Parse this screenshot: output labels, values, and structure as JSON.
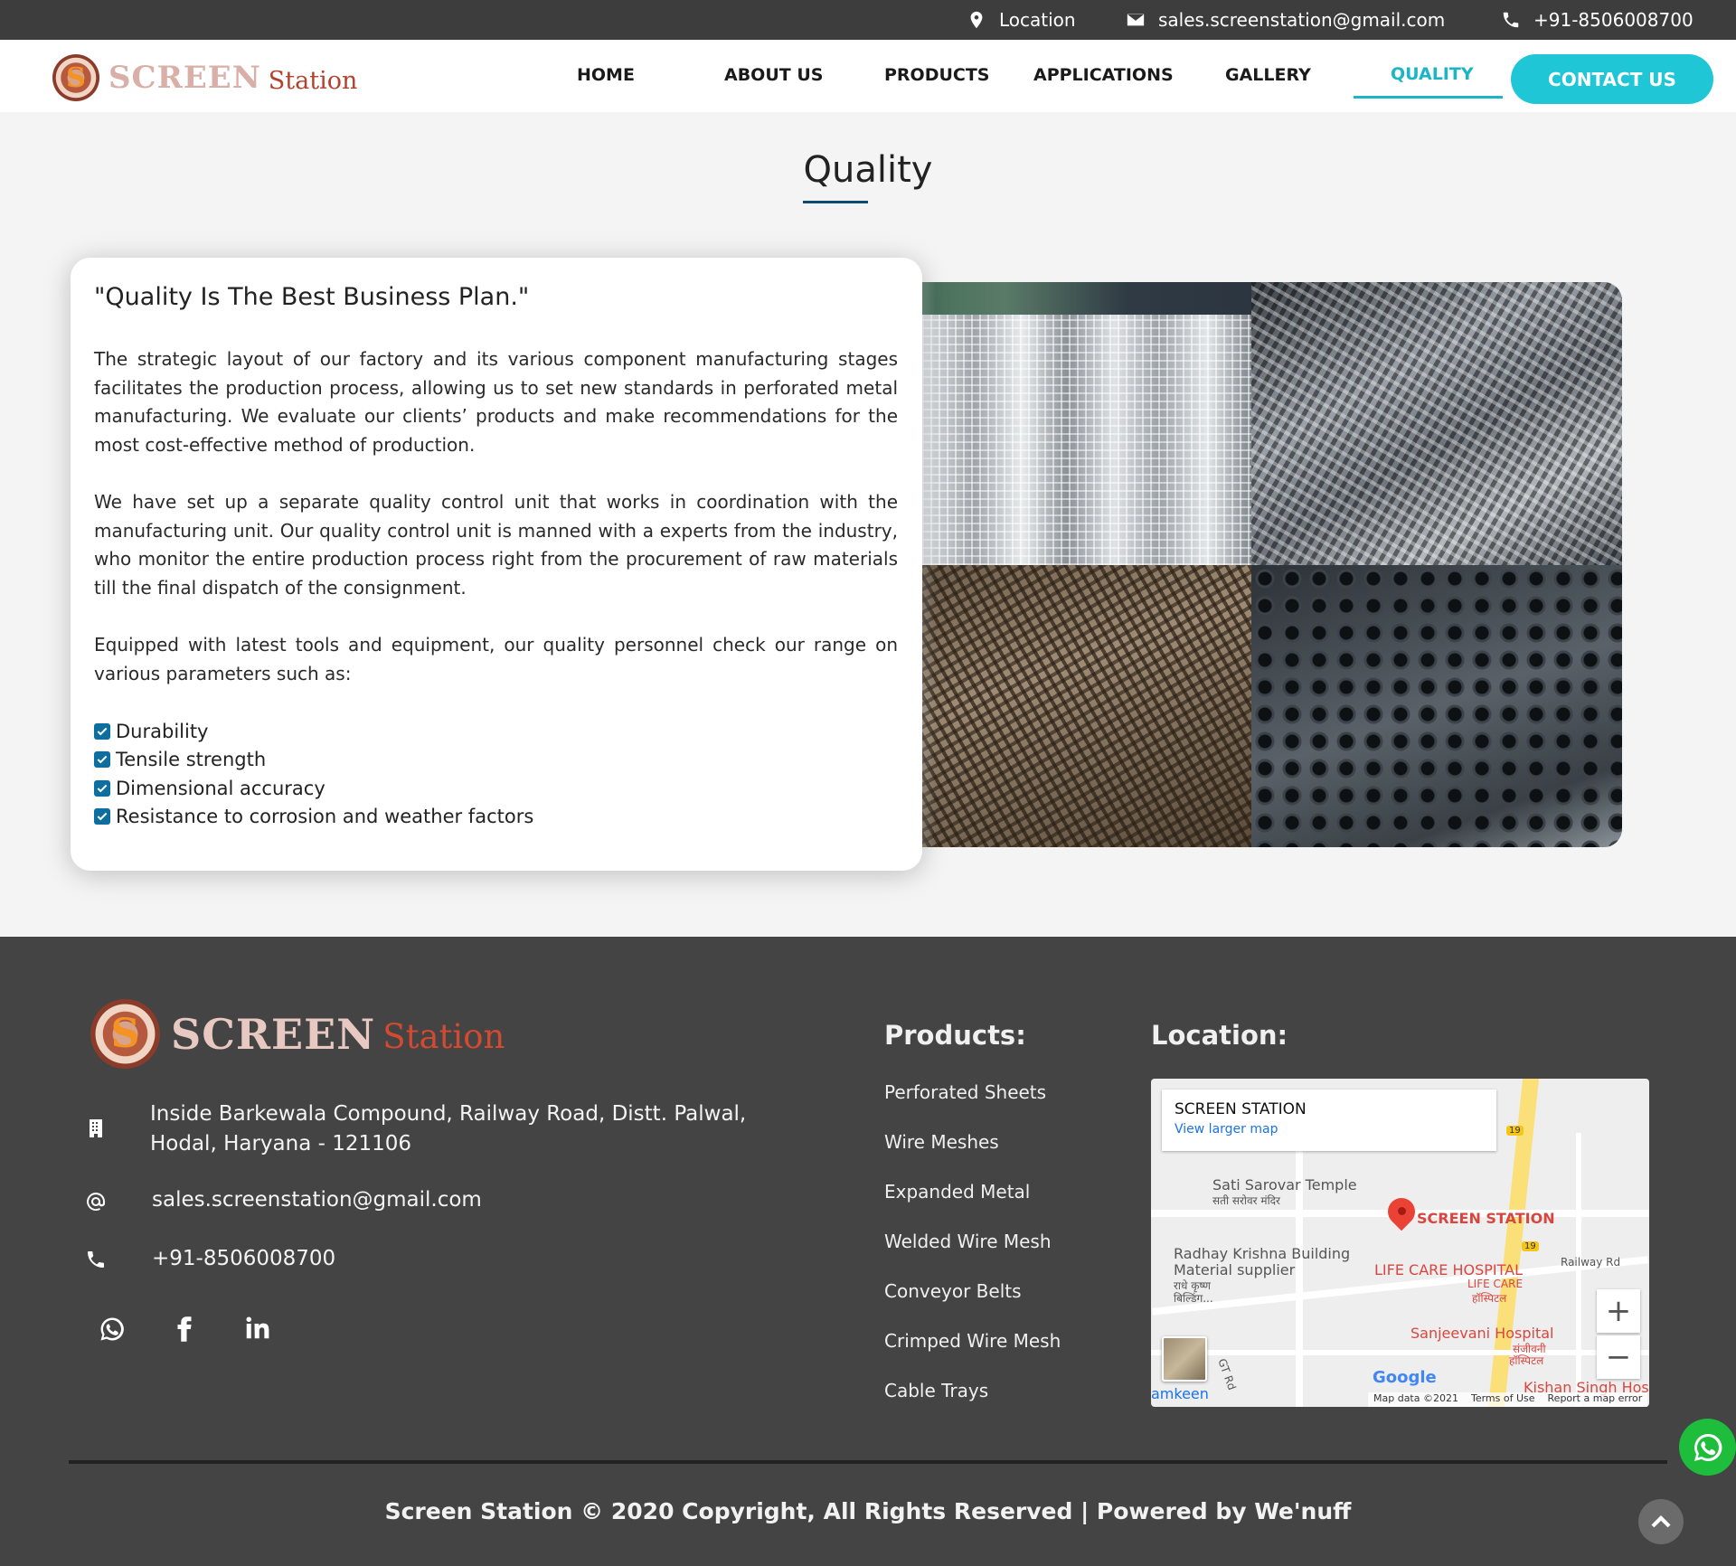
{
  "topbar": {
    "location": "Location",
    "email": "sales.screenstation@gmail.com",
    "phone": "+91-8506008700"
  },
  "logo": {
    "word1": "SCREEN",
    "word2": "Station",
    "seal_letter": "S"
  },
  "nav": {
    "items": [
      "HOME",
      "ABOUT US",
      "PRODUCTS",
      "APPLICATIONS",
      "GALLERY",
      "QUALITY"
    ],
    "active": "QUALITY",
    "contact": "CONTACT US"
  },
  "page": {
    "title": "Quality"
  },
  "quality": {
    "quote": "\"Quality Is The Best Business Plan.\"",
    "paragraphs": [
      "The strategic layout of our factory and its various component manufacturing stages facilitates the production process, allowing us to set new standards in perforated metal manufacturing. We evaluate our clients’ products and make recommendations for the most cost-effective method of production.",
      "We have set up a separate quality control unit that works in coordination with the manufacturing unit. Our quality control unit is manned with a experts from the industry, who monitor the entire production process right from the procurement of raw materials till the final dispatch of the consignment.",
      "Equipped with latest tools and equipment, our quality personnel check our range on various parameters such as:"
    ],
    "checklist": [
      "Durability",
      "Tensile strength",
      "Dimensional accuracy",
      "Resistance to corrosion and weather factors"
    ]
  },
  "footer": {
    "address": "Inside Barkewala Compound, Railway Road, Distt. Palwal, Hodal, Haryana - 121106",
    "email": "sales.screenstation@gmail.com",
    "phone": "+91-8506008700",
    "products_heading": "Products:",
    "products": [
      "Perforated Sheets",
      "Wire Meshes",
      "Expanded Metal",
      "Welded Wire Mesh",
      "Conveyor Belts",
      "Crimped Wire Mesh",
      "Cable Trays"
    ],
    "location_heading": "Location:",
    "map": {
      "title": "SCREEN STATION",
      "link": "View larger map",
      "marker": "SCREEN STATION",
      "places": [
        "Sati Sarovar Temple",
        "सती सरोवर मंदिर",
        "Radhay Krishna Building",
        "Material supplier",
        "राधे कृष्ण",
        "बिल्डिंग...",
        "LIFE CARE HOSPITAL",
        "LIFE CARE",
        "हॉस्पिटल",
        "Sanjeevani Hospital",
        "संजीवनी",
        "हॉस्पिटल",
        "Kishan Singh Hos",
        "amkeen",
        "Railway Rd",
        "GT Rd",
        "19"
      ],
      "brand": "Google",
      "footer_items": [
        "Map data ©2021",
        "Terms of Use",
        "Report a map error"
      ],
      "zoom_in": "+",
      "zoom_out": "−"
    },
    "copyright": "Screen Station © 2020 Copyright, All Rights Reserved | Powered by We'nuff"
  },
  "colors": {
    "accent": "#1ab5c7",
    "topbar": "#3d3d3d",
    "footer": "#444444",
    "checkbox": "#0c6fa0",
    "whatsapp": "#1ebe3c"
  },
  "icons": [
    "map-pin-icon",
    "envelope-icon",
    "phone-icon",
    "building-icon",
    "at-icon",
    "whatsapp-icon",
    "facebook-icon",
    "linkedin-icon",
    "check-icon",
    "chevron-up-icon"
  ]
}
